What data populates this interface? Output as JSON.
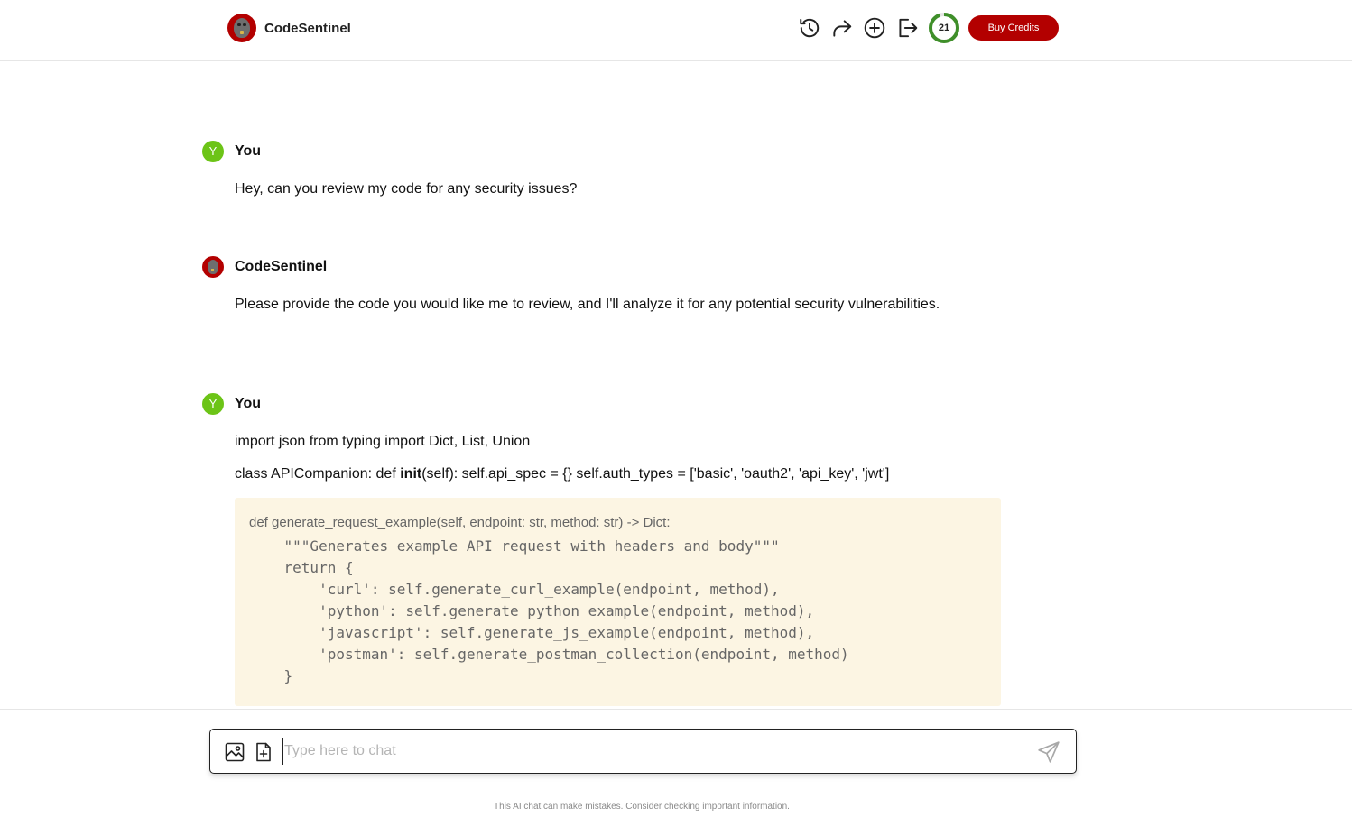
{
  "header": {
    "brand_name": "CodeSentinel",
    "credits": "21",
    "credits_fraction": 0.95,
    "buy_label": "Buy Credits",
    "icons": [
      "history-icon",
      "share-icon",
      "new-chat-icon",
      "logout-icon"
    ],
    "accent_color": "#b30000",
    "ring_color": "#3f8f2a"
  },
  "messages": [
    {
      "author": "You",
      "avatar_letter": "Y",
      "text": "Hey, can you review my code for any security issues?"
    },
    {
      "author": "CodeSentinel",
      "text": "Please provide the code you would like me to review, and I'll analyze it for any potential security vulnerabilities."
    },
    {
      "author": "You",
      "avatar_letter": "Y",
      "line1": "import json from typing import Dict, List, Union",
      "line2_prefix": "class APICompanion: def ",
      "line2_bold": "init",
      "line2_suffix": "(self): self.api_spec = {} self.auth_types = ['basic', 'oauth2', 'api_key', 'jwt']",
      "code_first": "def generate_request_example(self, endpoint: str, method: str) -> Dict:",
      "code_lines": [
        "    \"\"\"Generates example API request with headers and body\"\"\"",
        "    return {",
        "        'curl': self.generate_curl_example(endpoint, method),",
        "        'python': self.generate_python_example(endpoint, method),",
        "        'javascript': self.generate_js_example(endpoint, method),",
        "        'postman': self.generate_postman_collection(endpoint, method)",
        "    }"
      ]
    }
  ],
  "input": {
    "placeholder": "Type here to chat",
    "value": ""
  },
  "footer": {
    "disclaimer": "This AI chat can make mistakes. Consider checking important information."
  }
}
